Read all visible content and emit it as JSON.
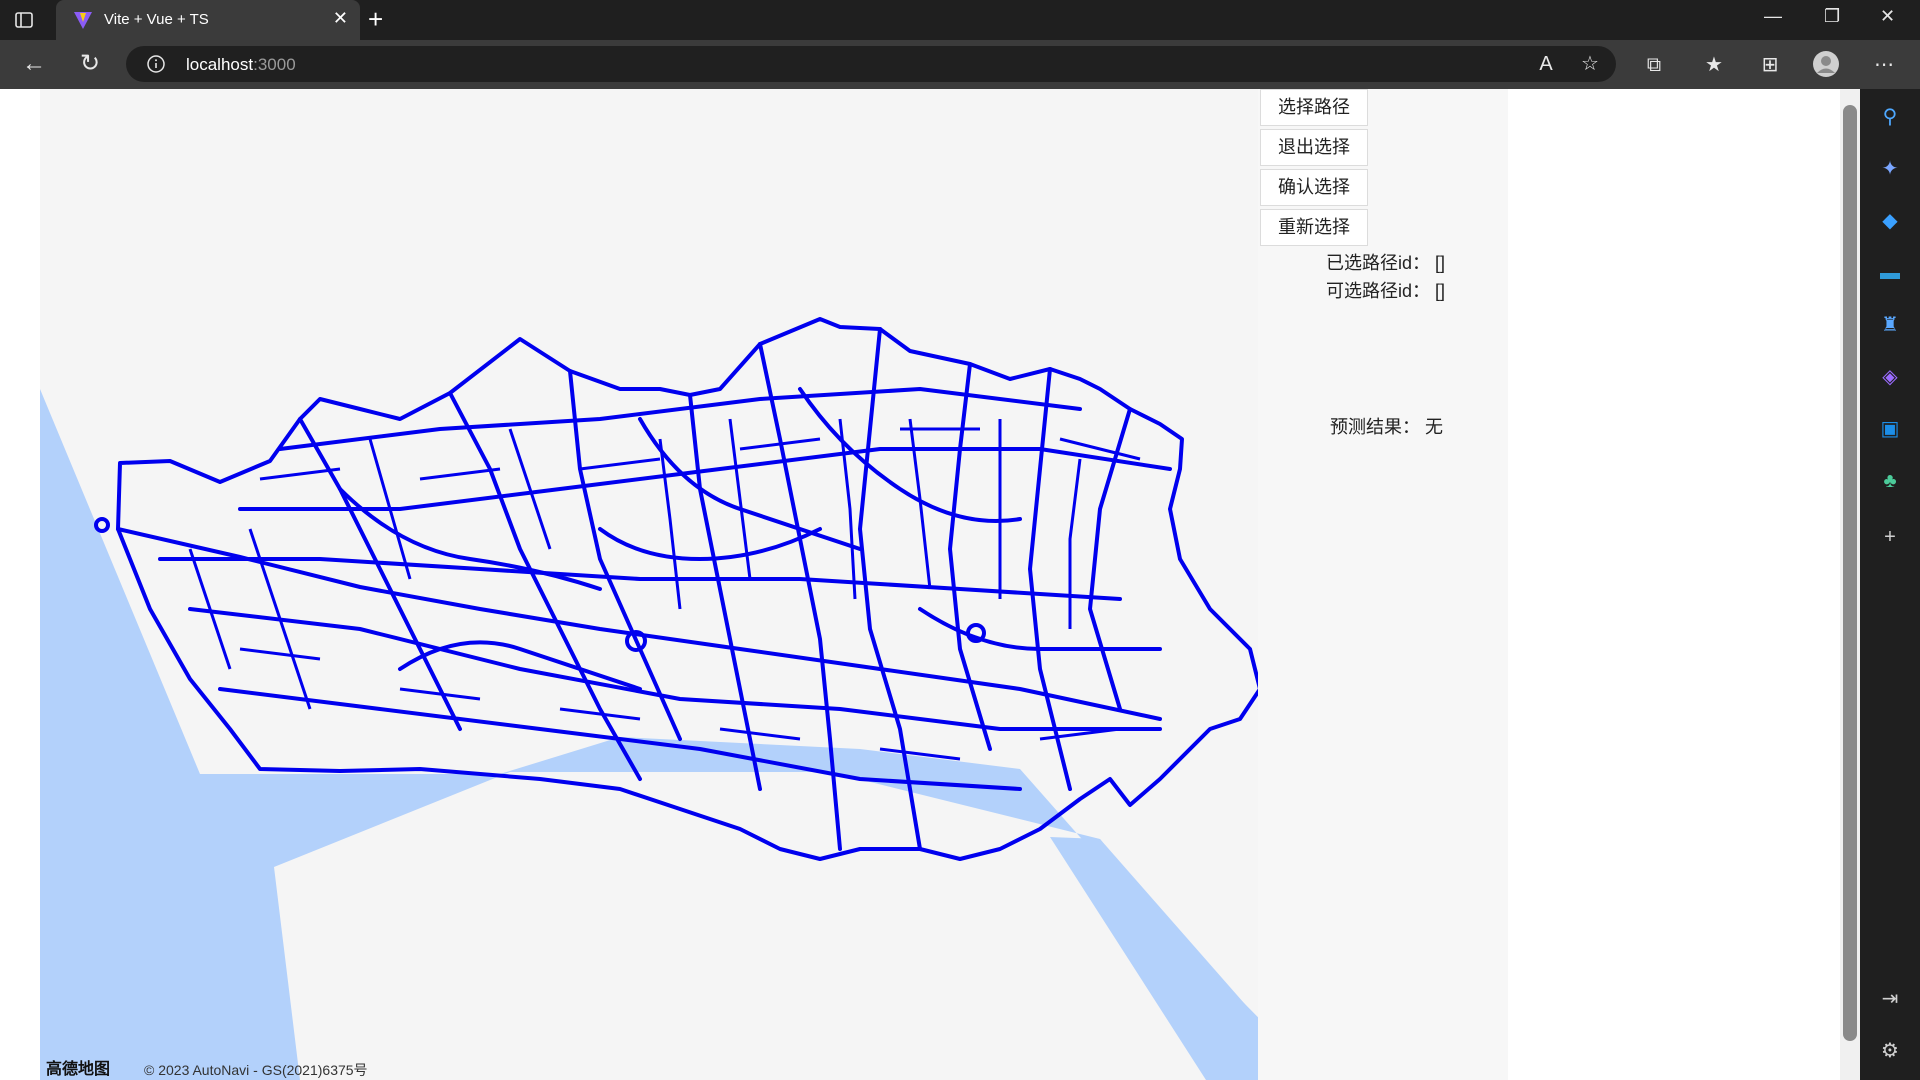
{
  "browser": {
    "tab_title": "Vite + Vue + TS",
    "new_tab_label": "+",
    "address_host": "localhost",
    "address_port": ":3000"
  },
  "controls": {
    "select_route": "选择路径",
    "exit_select": "退出选择",
    "confirm_select": "确认选择",
    "reselect": "重新选择"
  },
  "info": {
    "selected_label": "已选路径id：",
    "selected_value": "[]",
    "available_label": "可选路径id：",
    "available_value": "[]",
    "prediction_label": "预测结果：",
    "prediction_value": "无"
  },
  "map": {
    "logo_text": "高德地图",
    "copyright": "© 2023 AutoNavi - GS(2021)6375号",
    "road_color": "#0000ee",
    "water_color": "#b3d1fb",
    "land_color": "#f5f5f5"
  },
  "icons": {
    "tab_actions": "tab-actions-icon",
    "back": "back-icon",
    "refresh": "refresh-icon",
    "info": "info-icon",
    "read_aloud": "read-aloud-icon",
    "favorite_add": "favorite-add-icon",
    "extensions": "extensions-icon",
    "favorites": "favorites-icon",
    "collections": "collections-icon",
    "profile": "profile-icon",
    "more": "more-icon"
  }
}
